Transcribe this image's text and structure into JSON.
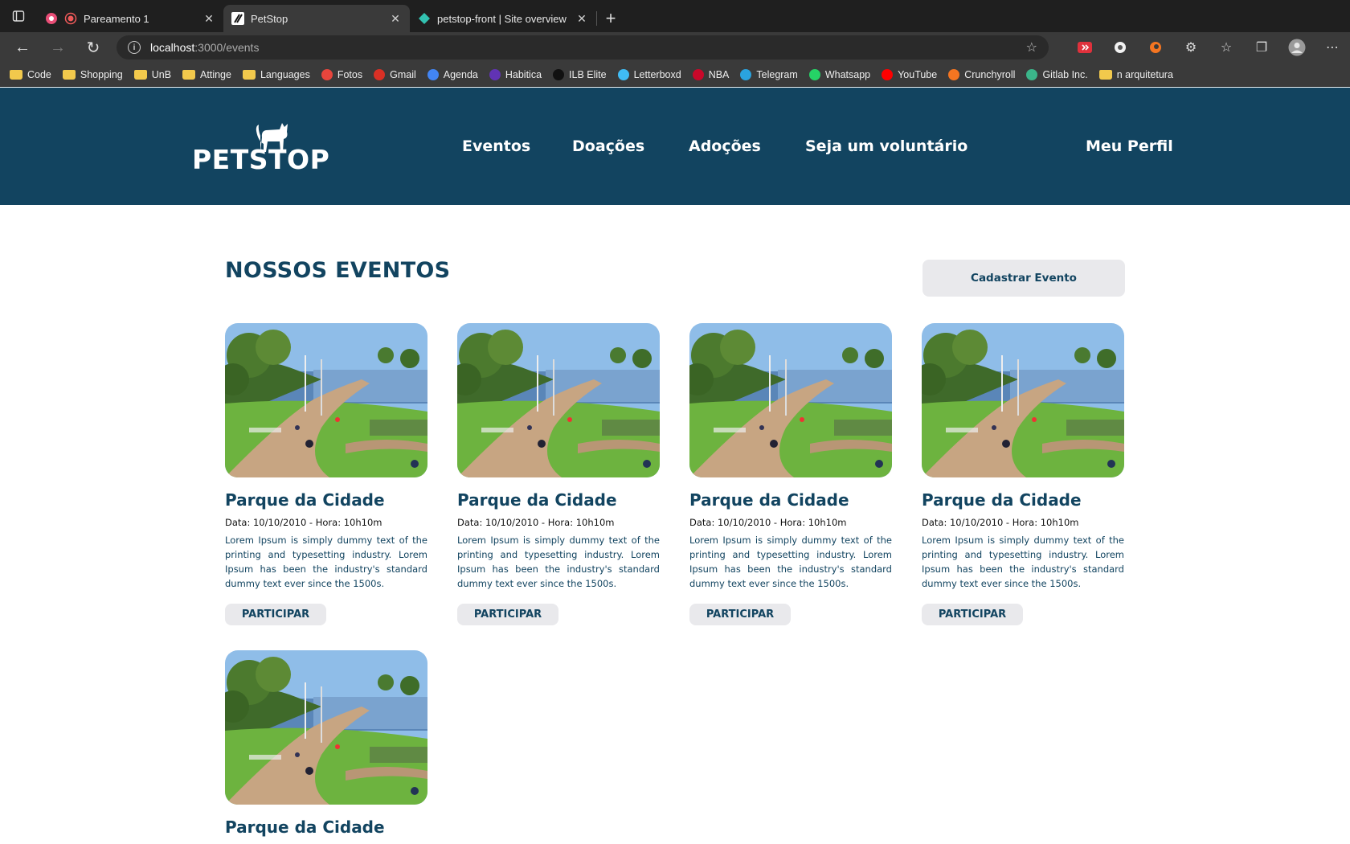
{
  "browser": {
    "tabs": [
      {
        "title": "Pareamento 1",
        "active": false
      },
      {
        "title": "PetStop",
        "active": true
      },
      {
        "title": "petstop-front | Site overview",
        "active": false
      }
    ],
    "url_host": "localhost",
    "url_path": ":3000/events",
    "bookmarks": [
      {
        "label": "Code",
        "icon": "folder-icon"
      },
      {
        "label": "Shopping",
        "icon": "folder-icon"
      },
      {
        "label": "UnB",
        "icon": "folder-icon"
      },
      {
        "label": "Attinge",
        "icon": "folder-icon"
      },
      {
        "label": "Languages",
        "icon": "folder-icon"
      },
      {
        "label": "Fotos",
        "icon": "photos-icon",
        "color": "#e8453c"
      },
      {
        "label": "Gmail",
        "icon": "gmail-icon",
        "color": "#d93025"
      },
      {
        "label": "Agenda",
        "icon": "calendar-icon",
        "color": "#4285f4"
      },
      {
        "label": "Habitica",
        "icon": "habitica-icon",
        "color": "#6133b4"
      },
      {
        "label": "ILB Elite",
        "icon": "ilb-icon",
        "color": "#111111"
      },
      {
        "label": "Letterboxd",
        "icon": "letterboxd-icon",
        "color": "#40bcf4"
      },
      {
        "label": "NBA",
        "icon": "nba-icon",
        "color": "#c9082a"
      },
      {
        "label": "Telegram",
        "icon": "telegram-icon",
        "color": "#2aa3df"
      },
      {
        "label": "Whatsapp",
        "icon": "whatsapp-icon",
        "color": "#25d366"
      },
      {
        "label": "YouTube",
        "icon": "youtube-icon",
        "color": "#ff0000"
      },
      {
        "label": "Crunchyroll",
        "icon": "crunchyroll-icon",
        "color": "#f47521"
      },
      {
        "label": "Gitlab Inc.",
        "icon": "gitlab-icon",
        "color": "#3bb58a"
      },
      {
        "label": "n arquitetura",
        "icon": "folder-icon"
      }
    ]
  },
  "site": {
    "logo_text": "PETSTOP",
    "nav": [
      "Eventos",
      "Doações",
      "Adoções",
      "Seja um voluntário"
    ],
    "profile": "Meu Perfil",
    "brand_color": "#124460"
  },
  "main": {
    "title": "NOSSOS EVENTOS",
    "create_button": "Cadastrar Evento",
    "events": [
      {
        "title": "Parque da Cidade",
        "date": "Data: 10/10/2010 - Hora: 10h10m",
        "description": "Lorem Ipsum is simply dummy text of the printing and typesetting industry. Lorem Ipsum has been the industry's standard dummy text ever since the 1500s.",
        "button": "PARTICIPAR"
      },
      {
        "title": "Parque da Cidade",
        "date": "Data: 10/10/2010 - Hora: 10h10m",
        "description": "Lorem Ipsum is simply dummy text of the printing and typesetting industry. Lorem Ipsum has been the industry's standard dummy text ever since the 1500s.",
        "button": "PARTICIPAR"
      },
      {
        "title": "Parque da Cidade",
        "date": "Data: 10/10/2010 - Hora: 10h10m",
        "description": "Lorem Ipsum is simply dummy text of the printing and typesetting industry. Lorem Ipsum has been the industry's standard dummy text ever since the 1500s.",
        "button": "PARTICIPAR"
      },
      {
        "title": "Parque da Cidade",
        "date": "Data: 10/10/2010 - Hora: 10h10m",
        "description": "Lorem Ipsum is simply dummy text of the printing and typesetting industry. Lorem Ipsum has been the industry's standard dummy text ever since the 1500s.",
        "button": "PARTICIPAR"
      },
      {
        "title": "Parque da Cidade",
        "date": "",
        "description": "",
        "button": ""
      }
    ]
  }
}
